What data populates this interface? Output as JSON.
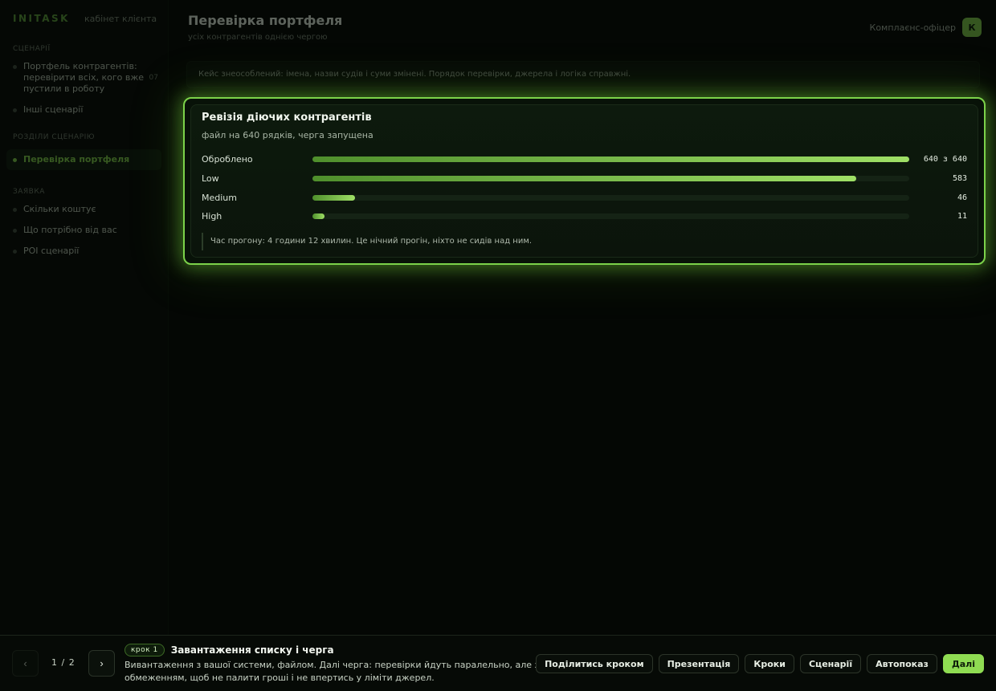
{
  "sidebar": {
    "brand": "INITASK",
    "brand_sub": "кабінет клієнта",
    "sections": [
      {
        "heading": "СЦЕНАРІЇ",
        "items": [
          {
            "label": "Портфель контрагентів: перевірити всіх, кого вже пустили в роботу",
            "count": "07"
          },
          {
            "label": "Інші сценарії"
          }
        ]
      },
      {
        "heading": "РОЗДІЛИ СЦЕНАРІЮ",
        "items": [
          {
            "label": "Перевірка портфеля",
            "active": true
          }
        ]
      },
      {
        "heading": "ЗАЯВКА",
        "items": [
          {
            "label": "Скільки коштує"
          },
          {
            "label": "Що потрібно від вас"
          },
          {
            "label": "РОІ сценарії"
          }
        ]
      }
    ]
  },
  "header": {
    "title": "Перевірка портфеля",
    "subtitle": "усіх контрагентів однією чергою",
    "user_name": "Комплаєнс-офіцер",
    "avatar_letter": "К"
  },
  "banner": {
    "text": "Кейс знеособлений: імена, назви судів і суми змінені. Порядок перевірки, джерела і логіка справжні."
  },
  "card": {
    "title": "Ревізія діючих контрагентів",
    "subtitle": "файл на 640 рядків, черга запущена",
    "rows": [
      {
        "label": "Оброблено",
        "value": "640 з 640",
        "fraction": 1.0
      },
      {
        "label": "Low",
        "value": "583",
        "fraction": 0.911
      },
      {
        "label": "Medium",
        "value": "46",
        "fraction": 0.072
      },
      {
        "label": "High",
        "value": "11",
        "fraction": 0.02
      }
    ],
    "note": "Час прогону: 4 години 12 хвилин. Це нічний прогін, ніхто не сидів над ним."
  },
  "footer": {
    "prev_icon": "‹",
    "next_icon": "›",
    "page_current": "1",
    "page_sep": "/",
    "page_total": "2",
    "step_badge": "крок 1",
    "step_title": "Завантаження списку і черга",
    "step_desc": "Вивантаження з вашої системи, файлом. Далі черга: перевірки йдуть паралельно, але з обмеженням, щоб не палити гроші і не впертись у ліміти джерел.",
    "actions": {
      "share": "Поділитись кроком",
      "presentation": "Презентація",
      "steps": "Кроки",
      "scenarios": "Сценарії",
      "autoplay": "Автопоказ",
      "next": "Далі"
    }
  },
  "colors": {
    "accent": "#8fdc52",
    "background": "#040704",
    "card_glow": "#7cd24a"
  }
}
